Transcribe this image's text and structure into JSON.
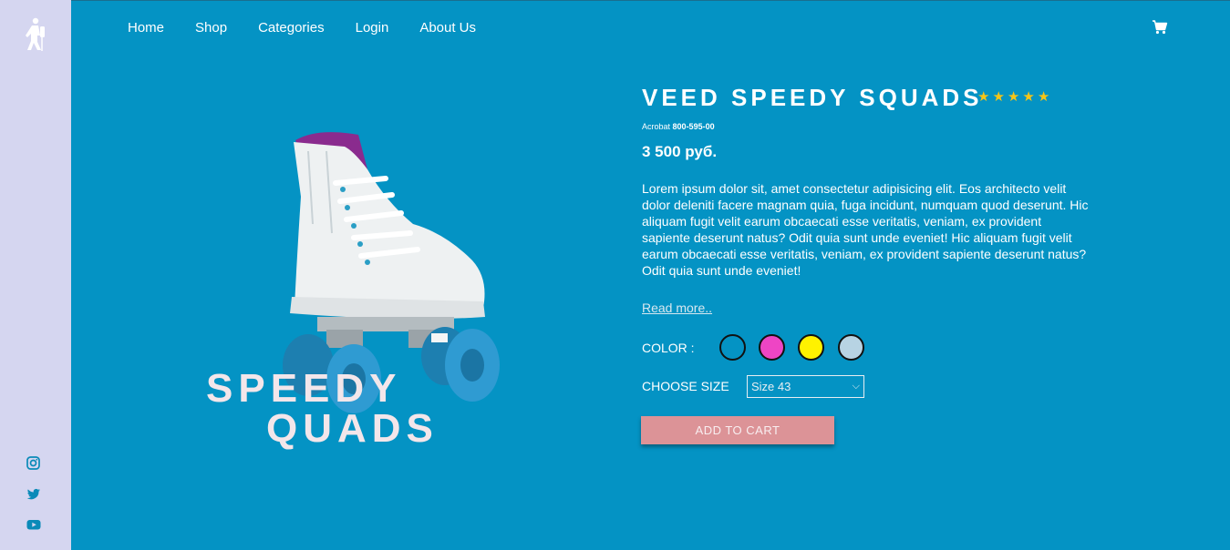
{
  "nav": {
    "items": [
      {
        "label": "Home"
      },
      {
        "label": "Shop"
      },
      {
        "label": "Categories"
      },
      {
        "label": "Login"
      },
      {
        "label": "About Us"
      }
    ],
    "cart_icon": "shopping-cart-icon",
    "logo_icon": "hiker-logo-icon"
  },
  "sidebar": {
    "social": [
      {
        "icon": "instagram-icon"
      },
      {
        "icon": "twitter-icon"
      },
      {
        "icon": "youtube-icon"
      }
    ]
  },
  "hero": {
    "line1": "SPEEDY",
    "line2": "QUADS"
  },
  "product": {
    "title": "VEED SPEEDY SQUADS",
    "rating": 5,
    "rating_max": 5,
    "sku_prefix": "Acrobat",
    "sku": "800-595-00",
    "price": "3 500 руб.",
    "description": "Lorem ipsum dolor sit, amet consectetur adipisicing elit. Eos architecto velit dolor deleniti facere magnam quia, fuga incidunt, numquam quod deserunt. Hic aliquam fugit velit earum obcaecati esse veritatis, veniam, ex provident sapiente deserunt natus? Odit quia sunt unde eveniet! Hic aliquam fugit velit earum obcaecati esse veritatis, veniam, ex provident sapiente deserunt natus? Odit quia sunt unde eveniet!",
    "read_more": "Read more..",
    "color_label": "COLOR :",
    "colors": [
      "#0493c4",
      "#ee45c4",
      "#fff200",
      "#b7d3e3"
    ],
    "size_label": "CHOOSE SIZE",
    "size_selected": "Size 43",
    "add_to_cart": "ADD TO CART"
  },
  "theme": {
    "background": "#0493c4",
    "sidebar": "#d5d6f0",
    "button": "#dc9397",
    "star": "#f5c518"
  }
}
